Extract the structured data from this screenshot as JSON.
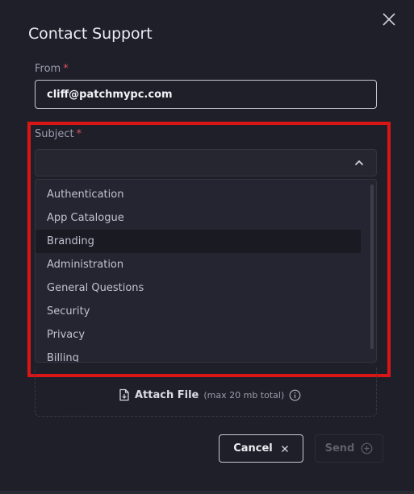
{
  "dialog": {
    "title": "Contact Support"
  },
  "icons": {
    "close": "close-icon",
    "chevron": "chevron-up-icon",
    "file": "file-icon",
    "info": "info-icon",
    "send": "plus-circle-icon",
    "cancel": "x-icon"
  },
  "from": {
    "label": "From",
    "required_mark": "*",
    "value": "cliff@patchmypc.com"
  },
  "subject": {
    "label": "Subject",
    "required_mark": "*",
    "value": "",
    "options": [
      "Authentication",
      "App Catalogue",
      "Branding",
      "Administration",
      "General Questions",
      "Security",
      "Privacy",
      "Billing"
    ],
    "hovered_option": "Branding"
  },
  "attach": {
    "label": "Attach File",
    "note": "(max 20 mb total)"
  },
  "buttons": {
    "cancel": "Cancel",
    "send": "Send"
  },
  "colors": {
    "highlight": "#d81616",
    "required": "#e0515a",
    "background": "#1f1f29"
  }
}
